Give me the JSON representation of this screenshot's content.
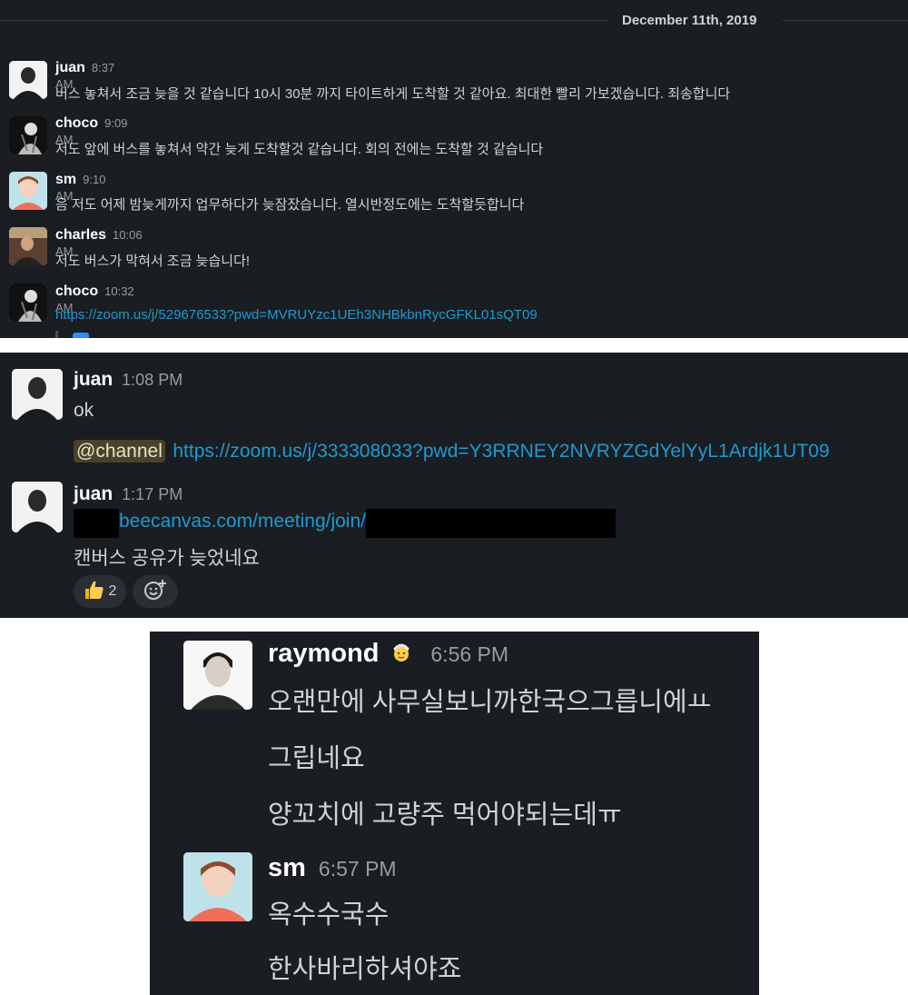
{
  "panel1": {
    "date": "December 11th, 2019",
    "messages": [
      {
        "user": "juan",
        "time": "8:37 AM",
        "text": "버스 놓쳐서 조금 늦을 것 같습니다 10시 30분 까지 타이트하게 도착할 것 같아요. 최대한 빨리 가보겠습니다. 죄송합니다"
      },
      {
        "user": "choco",
        "time": "9:09 AM",
        "text": "저도 앞에 버스를 놓쳐서 약간 늦게 도착할것 같습니다. 회의 전에는 도착할 것 같습니다"
      },
      {
        "user": "sm",
        "time": "9:10 AM",
        "text": "음 저도 어제 밤늦게까지 업무하다가 늦잠잤습니다. 열시반정도에는 도착할듯합니다"
      },
      {
        "user": "charles",
        "time": "10:06 AM",
        "text": "저도 버스가 막혀서 조금 늦습니다!"
      },
      {
        "user": "choco",
        "time": "10:32 AM",
        "link": "https://zoom.us/j/529676533?pwd=MVRUYzc1UEh3NHBkbnRycGFKL01sQT09"
      }
    ]
  },
  "panel2": {
    "msg1": {
      "user": "juan",
      "time": "1:08 PM",
      "text": "ok",
      "mention": "@channel",
      "link": "https://zoom.us/j/333308033?pwd=Y3RRNEY2NVRYZGdYelYyL1Ardjk1UT09"
    },
    "msg2": {
      "user": "juan",
      "time": "1:17 PM",
      "link": "beecanvas.com/meeting/join/",
      "text": "캔버스 공유가 늦었네요",
      "reaction_count": "2"
    }
  },
  "panel3": {
    "msg1": {
      "user": "raymond",
      "time": "6:56 PM",
      "lines": [
        "오랜만에 사무실보니까한국으그릅니에ㅛ",
        "그립네요",
        "양꼬치에 고량주 먹어야되는데ㅠ"
      ]
    },
    "msg2": {
      "user": "sm",
      "time": "6:57 PM",
      "lines": [
        "옥수수국수",
        "한사바리하셔야죠"
      ]
    }
  },
  "colors": {
    "background": "#1a1d21",
    "link": "#1d9bd1",
    "text": "#d1d2d3",
    "mention_bg": "#4a4228"
  }
}
